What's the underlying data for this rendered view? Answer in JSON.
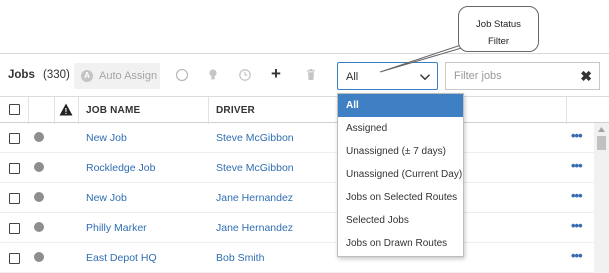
{
  "callout": {
    "line1": "Job Status",
    "line2": "Filter"
  },
  "toolbar": {
    "title": "Jobs",
    "count": "(330)",
    "auto_assign_icon": "A",
    "auto_assign_label": "Auto Assign",
    "add_icon": "+",
    "status_filter_value": "All",
    "filter_placeholder": "Filter jobs",
    "clear_icon": "✖"
  },
  "table": {
    "headers": {
      "warning": "!",
      "job_name": "JOB NAME",
      "driver": "DRIVER"
    },
    "rows": [
      {
        "job": "New Job",
        "driver": "Steve McGibbon",
        "more": "•••"
      },
      {
        "job": "Rockledge Job",
        "driver": "Steve McGibbon",
        "more": "•••"
      },
      {
        "job": "New Job",
        "driver": "Jane Hernandez",
        "more": "•••"
      },
      {
        "job": "Philly Marker",
        "driver": "Jane Hernandez",
        "more": "•••"
      },
      {
        "job": "East Depot HQ",
        "driver": "Bob Smith",
        "more": "•••"
      }
    ]
  },
  "dropdown": {
    "selected_index": 0,
    "options": [
      "All",
      "Assigned",
      "Unassigned (± 7 days)",
      "Unassigned (Current Day)",
      "Jobs on Selected Routes",
      "Selected Jobs",
      "Jobs on Drawn Routes"
    ]
  },
  "colors": {
    "link": "#2f6fb3",
    "accent": "#3f80c4",
    "status_dot": "#8e8e8e"
  }
}
